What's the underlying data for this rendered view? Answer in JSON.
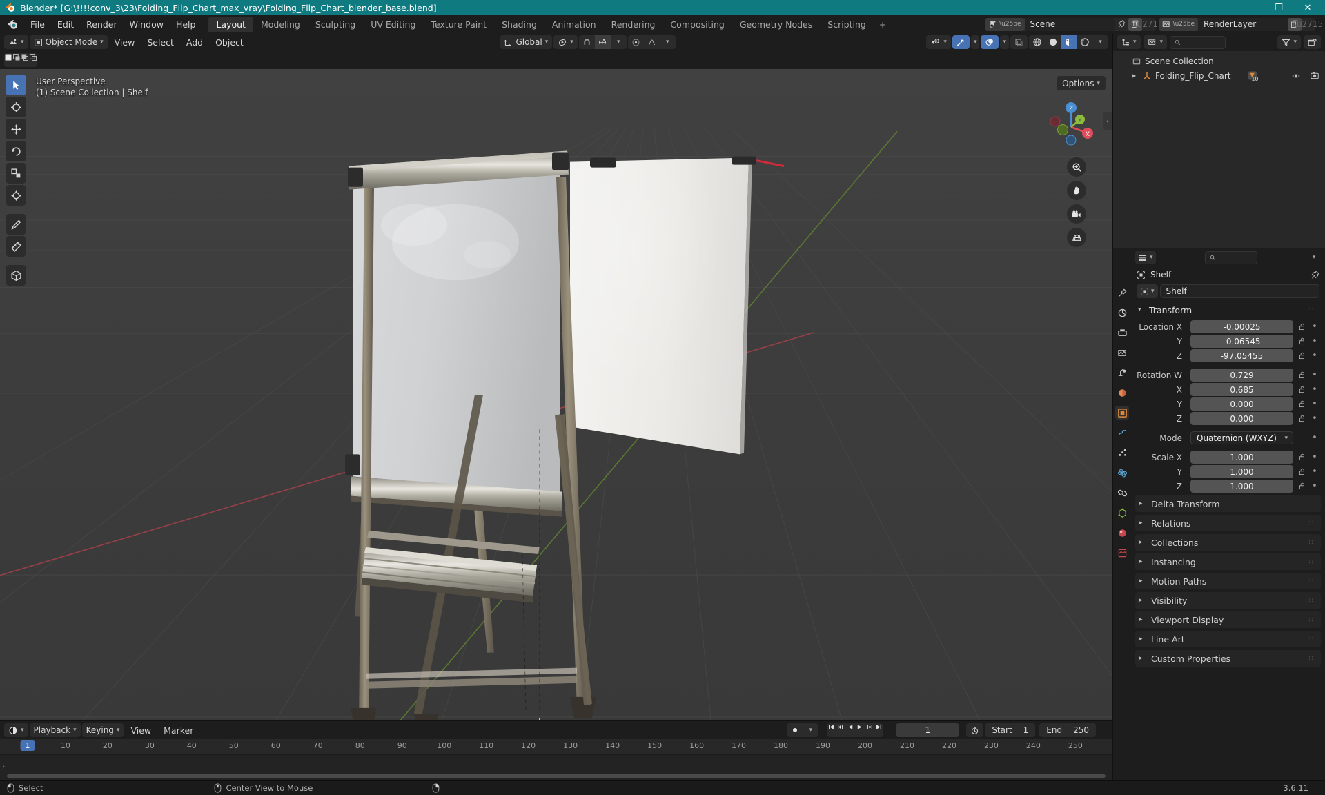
{
  "window": {
    "title": "Blender* [G:\\!!!!conv_3\\23\\Folding_Flip_Chart_max_vray\\Folding_Flip_Chart_blender_base.blend]",
    "minimize": "–",
    "maximize": "❐",
    "close": "✕"
  },
  "topbar": {
    "menus": [
      "File",
      "Edit",
      "Render",
      "Window",
      "Help"
    ],
    "workspaces": [
      {
        "label": "Layout",
        "active": true
      },
      {
        "label": "Modeling",
        "active": false
      },
      {
        "label": "Sculpting",
        "active": false
      },
      {
        "label": "UV Editing",
        "active": false
      },
      {
        "label": "Texture Paint",
        "active": false
      },
      {
        "label": "Shading",
        "active": false
      },
      {
        "label": "Animation",
        "active": false
      },
      {
        "label": "Rendering",
        "active": false
      },
      {
        "label": "Compositing",
        "active": false
      },
      {
        "label": "Geometry Nodes",
        "active": false
      },
      {
        "label": "Scripting",
        "active": false
      }
    ],
    "add_workspace": "+",
    "scene_name": "Scene",
    "viewlayer_name": "RenderLayer"
  },
  "viewport": {
    "mode": "Object Mode",
    "menus": [
      "View",
      "Select",
      "Add",
      "Object"
    ],
    "transform_orientation": "Global",
    "options_label": "Options",
    "info_line1": "User Perspective",
    "info_line2": "(1) Scene Collection | Shelf",
    "gizmo_axes": {
      "x": "X",
      "y": "Y",
      "z": "Z"
    },
    "shading_modes": [
      "wireframe",
      "solid",
      "material-preview",
      "rendered"
    ],
    "active_shading": "material-preview",
    "nav_buttons": [
      "zoom-icon",
      "pan-hand-icon",
      "camera-view-icon",
      "toggle-perspective-icon"
    ],
    "tools": [
      "tweak-select-tool",
      "cursor-tool",
      "move-tool",
      "rotate-tool",
      "scale-tool",
      "transform-tool",
      "annotate-tool",
      "measure-tool",
      "add-cube-tool"
    ]
  },
  "timeline": {
    "editor_type": "timeline-editor-icon",
    "menus": [
      "Playback",
      "Keying",
      "View",
      "Marker"
    ],
    "current_frame": "1",
    "start_label": "Start",
    "start_value": "1",
    "end_label": "End",
    "end_value": "250",
    "ticks": [
      "10",
      "20",
      "30",
      "40",
      "50",
      "60",
      "70",
      "80",
      "90",
      "100",
      "110",
      "120",
      "130",
      "140",
      "150",
      "160",
      "170",
      "180",
      "190",
      "200",
      "210",
      "220",
      "230",
      "240",
      "250"
    ]
  },
  "outliner": {
    "display_mode": "View Layer",
    "search_placeholder": "",
    "rows": [
      {
        "label": "Scene Collection",
        "icon": "collection-icon",
        "indent": 0,
        "expander": "",
        "badge": ""
      },
      {
        "label": "Folding_Flip_Chart",
        "icon": "empty-axes-icon",
        "indent": 1,
        "expander": "▶",
        "badge": "10"
      }
    ]
  },
  "properties": {
    "breadcrumb": "Shelf",
    "object_name": "Shelf",
    "tabs": [
      "tool-icon",
      "render-icon",
      "output-icon",
      "view-layer-icon",
      "scene-icon",
      "world-icon",
      "object-icon",
      "modifier-icon",
      "particles-icon",
      "physics-icon",
      "constraint-icon",
      "data-icon",
      "material-icon",
      "texture-icon"
    ],
    "active_tab_index": 6,
    "transform": {
      "title": "Transform",
      "rows": [
        {
          "label": "Location X",
          "value": "-0.00025"
        },
        {
          "label": "Y",
          "value": "-0.06545"
        },
        {
          "label": "Z",
          "value": "-97.05455"
        }
      ],
      "rotation_rows": [
        {
          "label": "Rotation W",
          "value": "0.729"
        },
        {
          "label": "X",
          "value": "0.685"
        },
        {
          "label": "Y",
          "value": "0.000"
        },
        {
          "label": "Z",
          "value": "0.000"
        }
      ],
      "mode_label": "Mode",
      "mode_value": "Quaternion (WXYZ)",
      "scale_rows": [
        {
          "label": "Scale X",
          "value": "1.000"
        },
        {
          "label": "Y",
          "value": "1.000"
        },
        {
          "label": "Z",
          "value": "1.000"
        }
      ]
    },
    "panels": [
      "Delta Transform",
      "Relations",
      "Collections",
      "Instancing",
      "Motion Paths",
      "Visibility",
      "Viewport Display",
      "Line Art",
      "Custom Properties"
    ]
  },
  "statusbar": {
    "items": [
      {
        "icon": "mouse-left-icon",
        "label": "Select"
      },
      {
        "icon": "mouse-middle-icon",
        "label": "Center View to Mouse"
      },
      {
        "icon": "mouse-right-icon",
        "label": ""
      }
    ],
    "version": "3.6.11"
  },
  "colors": {
    "titlebar": "#0f7a7f",
    "accent_blue": "#4772b3",
    "axis_x": "#e04c5a",
    "axis_y": "#8dbd3f",
    "axis_z": "#4a8fd4",
    "viewport_bg": "#3b3b3b"
  }
}
